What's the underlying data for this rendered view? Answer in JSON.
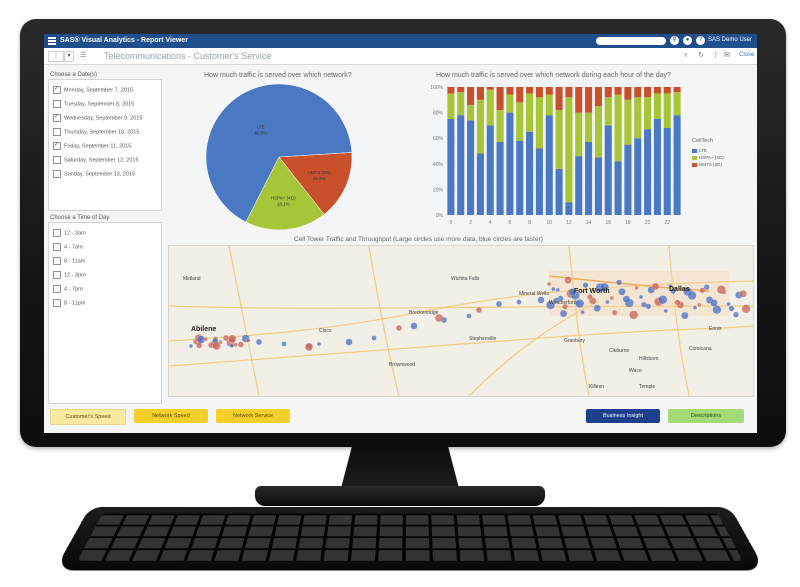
{
  "app": {
    "title": "SAS® Visual Analytics - Report Viewer",
    "user": "SAS Demo User"
  },
  "toolbar": {
    "report_title": "Telecommunications - Customer's Service",
    "close_label": "Close"
  },
  "date_panel": {
    "title": "Choose a Date(s)",
    "options": [
      {
        "label": "Monday, September 7, 2015",
        "checked": true
      },
      {
        "label": "Tuesday, September 8, 2015",
        "checked": false
      },
      {
        "label": "Wednesday, September 9, 2015",
        "checked": true
      },
      {
        "label": "Thursday, September 10, 2015",
        "checked": false
      },
      {
        "label": "Friday, September 11, 2015",
        "checked": true
      },
      {
        "label": "Saturday, September 12, 2015",
        "checked": false
      },
      {
        "label": "Sunday, September 13, 2015",
        "checked": false
      }
    ]
  },
  "time_panel": {
    "title": "Choose a Time of Day",
    "options": [
      {
        "label": "12 - 3am",
        "checked": false
      },
      {
        "label": "4 - 7am",
        "checked": false
      },
      {
        "label": "8 - 11am",
        "checked": false
      },
      {
        "label": "12 - 3pm",
        "checked": false
      },
      {
        "label": "4 - 7pm",
        "checked": false
      },
      {
        "label": "8 - 11pm",
        "checked": false
      }
    ]
  },
  "colors": {
    "lte": "#4a78c2",
    "hspa": "#a7c539",
    "umts": "#c8502a",
    "header": "#1f4e8c"
  },
  "chart_data": [
    {
      "type": "pie",
      "title": "How much traffic is served over which network?",
      "slices": [
        {
          "label": "LTE",
          "value_label": "66.5%",
          "value": 66.5
        },
        {
          "label": "HSPA+ (4G)",
          "value_label": "18.1%",
          "value": 18.1
        },
        {
          "label": "UMTS (3G)",
          "value_label": "15.4%",
          "value": 15.4
        }
      ]
    },
    {
      "type": "bar",
      "stacked": true,
      "title": "How much traffic is served over which network during each hour of the day?",
      "categories": [
        "0",
        "1",
        "2",
        "3",
        "4",
        "5",
        "6",
        "7",
        "8",
        "9",
        "10",
        "11",
        "12",
        "13",
        "14",
        "15",
        "16",
        "17",
        "18",
        "19",
        "20",
        "21",
        "22",
        "23"
      ],
      "xtick_labels": [
        "0",
        "2",
        "4",
        "6",
        "8",
        "10",
        "12",
        "14",
        "16",
        "18",
        "20",
        "22"
      ],
      "ytick_labels": [
        "0%",
        "20%",
        "40%",
        "60%",
        "80%",
        "100%"
      ],
      "ylim": [
        0,
        100
      ],
      "legend_title": "CellTech",
      "series": [
        {
          "name": "LTE",
          "values": [
            75,
            78,
            74,
            48,
            70,
            57,
            80,
            58,
            65,
            52,
            78,
            36,
            10,
            46,
            57,
            45,
            70,
            42,
            55,
            60,
            67,
            75,
            68,
            78
          ]
        },
        {
          "name": "HSPA+ (4G)",
          "values": [
            20,
            18,
            12,
            42,
            28,
            25,
            14,
            30,
            30,
            40,
            16,
            46,
            82,
            34,
            23,
            40,
            22,
            52,
            35,
            32,
            25,
            20,
            27,
            18
          ]
        },
        {
          "name": "UMTS (3G)",
          "values": [
            5,
            4,
            14,
            10,
            2,
            18,
            6,
            12,
            5,
            8,
            6,
            18,
            8,
            20,
            20,
            15,
            8,
            6,
            10,
            8,
            8,
            5,
            5,
            4
          ]
        }
      ]
    }
  ],
  "map": {
    "title": "Cell Tower Traffic and Throughput (Large circles use more data, blue circles are faster)",
    "places": [
      "Fort Worth",
      "Dallas",
      "Abilene"
    ],
    "minor_places": [
      "Wichita Falls",
      "Mineral Wells",
      "Weatherford",
      "Stephenville",
      "Brownwood",
      "Waco",
      "Ennis",
      "Corsicana",
      "Temple",
      "Killeen",
      "Midland",
      "Cisco",
      "Breckenridge",
      "Granbury",
      "Cleburne",
      "Hillsboro"
    ]
  },
  "bottom_buttons": [
    {
      "label": "Customer's Speed",
      "color": "#f9eaa2"
    },
    {
      "label": "Network Speed",
      "color": "#f5cf2a"
    },
    {
      "label": "Network Service",
      "color": "#f5cf2a"
    },
    {
      "label": "Business Insight",
      "color": "#1d3f8c"
    },
    {
      "label": "Descriptions",
      "color": "#a3d977"
    }
  ]
}
